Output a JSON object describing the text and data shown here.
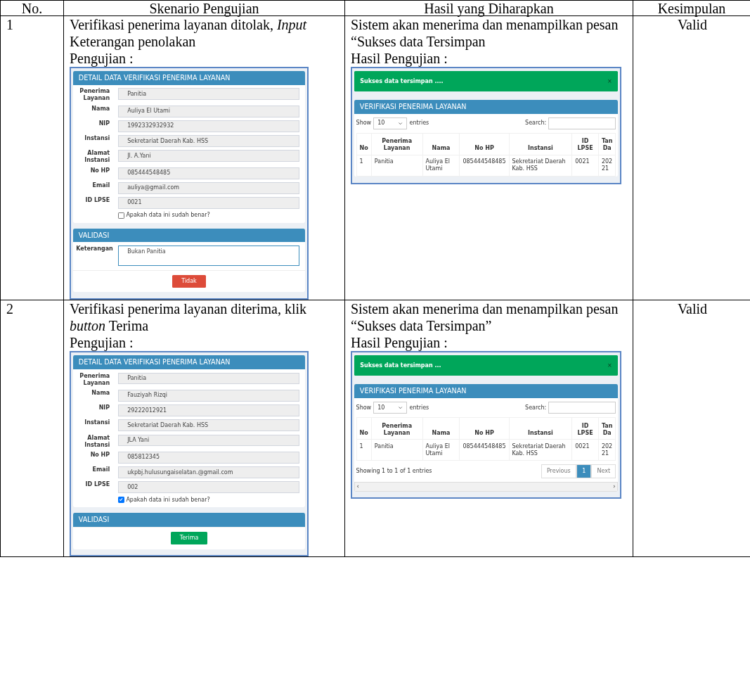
{
  "table": {
    "columns": [
      "No.",
      "Skenario Pengujian",
      "Hasil yang Diharapkan",
      "Kesimpulan"
    ],
    "rows": [
      {
        "no": "1",
        "scenario": "Verifikasi penerima layanan ditolak, *Input* Keterangan penolakan",
        "test_label": "Pengujian :",
        "form": {
          "title": "DETAIL DATA VERIFIKASI PENERIMA LAYANAN",
          "fields": [
            {
              "label": "Penerima Layanan",
              "value": "Panitia"
            },
            {
              "label": "Nama",
              "value": "Auliya El Utami"
            },
            {
              "label": "NIP",
              "value": "1992332932932"
            },
            {
              "label": "Instansi",
              "value": "Sekretariat Daerah Kab. HSS"
            },
            {
              "label": "Alamat Instansi",
              "value": "Jl. A.Yani"
            },
            {
              "label": "No HP",
              "value": "085444548485"
            },
            {
              "label": "Email",
              "value": "auliya@gmail.com"
            },
            {
              "label": "ID LPSE",
              "value": "0021"
            }
          ],
          "checkbox": {
            "label": "Apakah data ini sudah benar?",
            "checked": false
          },
          "validation": {
            "title": "VALIDASI",
            "fields": [
              {
                "label": "Keterangan",
                "value": "Bukan Panitia"
              }
            ]
          },
          "button": {
            "label": "Tidak",
            "kind": "danger"
          }
        },
        "expected": "Sistem akan menerima dan menampilkan pesan “Sukses data Tersimpan",
        "result_label": "Hasil Pengujian :",
        "result": {
          "alert": "Sukses data tersimpan ....",
          "close": "×",
          "title": "VERIFIKASI PENERIMA LAYANAN",
          "show": "Show",
          "page_size": "10",
          "entries": "entries",
          "search": "Search:",
          "columns": [
            "No",
            "Penerima Layanan",
            "Nama",
            "No HP",
            "Instansi",
            "ID LPSE",
            "Tan Da"
          ],
          "rows": [
            [
              "1",
              "Panitia",
              "Auliya El Utami",
              "085444548485",
              "Sekretariat Daerah Kab. HSS",
              "0021",
              "202 21"
            ]
          ]
        },
        "conclusion": "Valid"
      },
      {
        "no": "2",
        "scenario": "Verifikasi penerima layanan diterima, klik *button* Terima",
        "test_label": "Pengujian :",
        "form": {
          "title": "DETAIL DATA VERIFIKASI PENERIMA LAYANAN",
          "fields": [
            {
              "label": "Penerima Layanan",
              "value": "Panitia"
            },
            {
              "label": "Nama",
              "value": "Fauziyah Rizqi"
            },
            {
              "label": "NIP",
              "value": "29222012921"
            },
            {
              "label": "Instansi",
              "value": "Sekretariat Daerah Kab. HSS"
            },
            {
              "label": "Alamat Instansi",
              "value": "JLA Yani"
            },
            {
              "label": "No HP",
              "value": "085812345"
            },
            {
              "label": "Email",
              "value": "ukpbj.hulusungaiselatan.@gmail.com"
            },
            {
              "label": "ID LPSE",
              "value": "002"
            }
          ],
          "checkbox": {
            "label": "Apakah data ini sudah benar?",
            "checked": true
          },
          "validation": {
            "title": "VALIDASI"
          },
          "button": {
            "label": "Terima",
            "kind": "success"
          }
        },
        "expected": "Sistem akan menerima dan menampilkan pesan “Sukses data Tersimpan”",
        "result_label": "Hasil Pengujian :",
        "result": {
          "alert": "Sukses data tersimpan ...",
          "close": "×",
          "title": "VERIFIKASI PENERIMA LAYANAN",
          "show": "Show",
          "page_size": "10",
          "entries": "entries",
          "search": "Search:",
          "columns": [
            "No",
            "Penerima Layanan",
            "Nama",
            "No HP",
            "Instansi",
            "ID LPSE",
            "Tan Da"
          ],
          "rows": [
            [
              "1",
              "Panitia",
              "Auliya El Utami",
              "085444548485",
              "Sekretariat Daerah Kab. HSS",
              "0021",
              "202 21"
            ]
          ],
          "info": "Showing 1 to 1 of 1 entries",
          "pages": [
            {
              "label": "Previous",
              "selected": false
            },
            {
              "label": "1",
              "selected": true
            },
            {
              "label": "Next",
              "selected": false
            }
          ],
          "scroll_left": "‹",
          "scroll_right": "›"
        },
        "conclusion": "Valid"
      }
    ]
  }
}
